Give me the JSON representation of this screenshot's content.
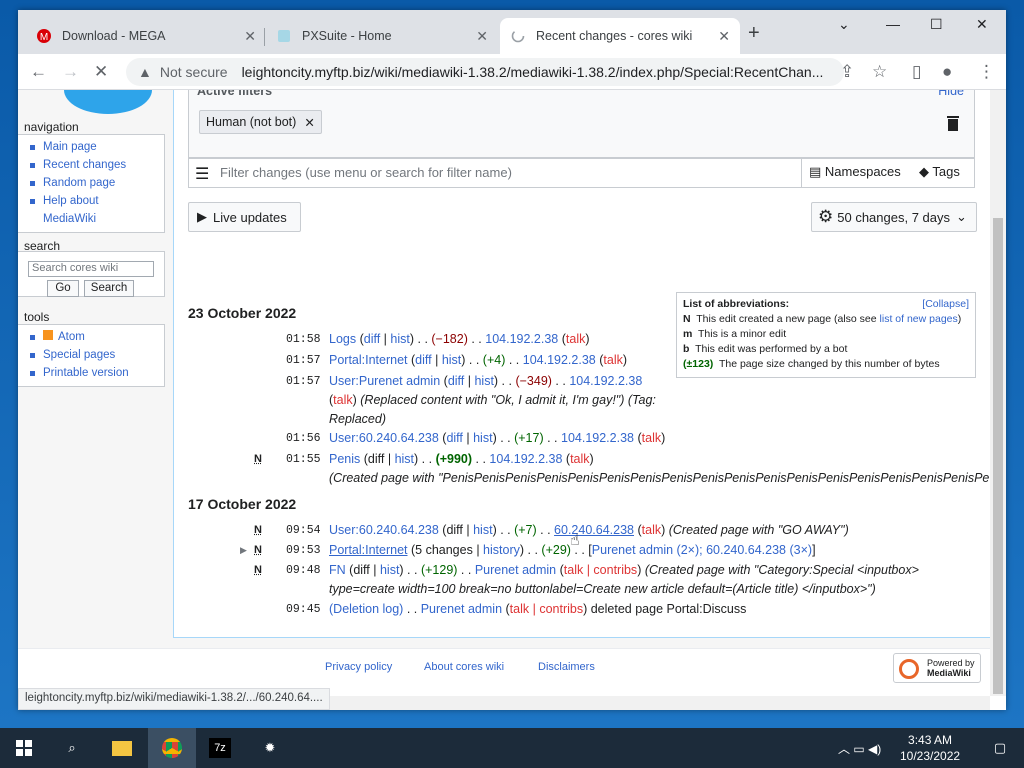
{
  "browser": {
    "tabs": [
      {
        "title": "Download - MEGA",
        "icon": "mega-icon"
      },
      {
        "title": "PXSuite - Home",
        "icon": "pxsuite-icon"
      },
      {
        "title": "Recent changes - cores wiki",
        "icon": "loading-icon"
      }
    ],
    "url_label": "Not secure",
    "url": "leightoncity.myftp.biz/wiki/mediawiki-1.38.2/mediawiki-1.38.2/index.php/Special:RecentChan...",
    "status_url": "leightoncity.myftp.biz/wiki/mediawiki-1.38.2/.../60.240.64...."
  },
  "sidebar": {
    "navigation": {
      "heading": "navigation",
      "items": [
        "Main page",
        "Recent changes",
        "Random page",
        "Help about",
        "MediaWiki"
      ]
    },
    "search": {
      "heading": "search",
      "placeholder": "Search cores wiki",
      "go": "Go",
      "search": "Search"
    },
    "tools": {
      "heading": "tools",
      "items": [
        "Atom",
        "Special pages",
        "Printable version"
      ]
    }
  },
  "filters": {
    "active_label": "Active filters",
    "hide": "Hide",
    "chip": "Human (not bot)",
    "search_placeholder": "Filter changes (use menu or search for filter name)",
    "namespaces": "Namespaces",
    "tags": "Tags",
    "live": "Live updates",
    "summary": "50 changes, 7 days"
  },
  "legend": {
    "title": "List of abbreviations:",
    "collapse": "[Collapse]",
    "n_key": "N",
    "n_text": "This edit created a new page (also see ",
    "n_link": "list of new pages",
    "n_end": ")",
    "m_key": "m",
    "m_text": "This is a minor edit",
    "b_key": "b",
    "b_text": "This edit was performed by a bot",
    "s_key": "(±123)",
    "s_text": "The page size changed by this number of bytes"
  },
  "days": [
    {
      "date": "23 October 2022",
      "rows": [
        {
          "flag": "",
          "time": "01:58",
          "page": "Logs",
          "diff": "diff",
          "hist": "hist",
          "size": "(−182)",
          "user": "104.192.2.38",
          "talk": "talk",
          "extra": ""
        },
        {
          "flag": "",
          "time": "01:57",
          "page": "Portal:Internet",
          "diff": "diff",
          "hist": "hist",
          "size": "(+4)",
          "user": "104.192.2.38",
          "talk": "talk",
          "extra": ""
        },
        {
          "flag": "",
          "time": "01:57",
          "page": "User:Purenet admin",
          "diff": "diff",
          "hist": "hist",
          "size": "(−349)",
          "user": "104.192.2.38",
          "talk": "talk",
          "extra": "(Replaced content with \"Ok, I admit it, I'm gay!\") (Tag: Replaced)"
        },
        {
          "flag": "",
          "time": "01:56",
          "page": "User:60.240.64.238",
          "diff": "diff",
          "hist": "hist",
          "size": "(+17)",
          "user": "104.192.2.38",
          "talk": "talk",
          "extra": ""
        },
        {
          "flag": "N",
          "time": "01:55",
          "page": "Penis",
          "diff": "diff",
          "hist": "hist",
          "size": "(+990)",
          "user": "104.192.2.38",
          "talk": "talk",
          "extra": "(Created page with \"PenisPenisPenisPenisPenisPenisPenisPenisPenisPenisPenisPenisPenisPenisPenisPenisPenisPenisPeni"
        }
      ]
    },
    {
      "date": "17 October 2022",
      "rows": [
        {
          "flag": "N",
          "time": "09:54",
          "page": "User:60.240.64.238",
          "diff": "diff",
          "hist": "hist",
          "size": "(+7)",
          "user": "60.240.64.238",
          "talk": "talk",
          "extra": "(Created page with \"GO AWAY\")"
        },
        {
          "flag": "N",
          "time": "09:53",
          "page": "Portal:Internet",
          "diff": "5 changes",
          "hist": "history",
          "size": "(+29)",
          "user": "Purenet admin (2×); 60.240.64.238 (3×)",
          "talk": "",
          "extra": ""
        },
        {
          "flag": "N",
          "time": "09:48",
          "page": "FN",
          "diff": "diff",
          "hist": "hist",
          "size": "(+129)",
          "user": "Purenet admin",
          "talk": "talk | contribs",
          "extra": "(Created page with \"Category:Special <inputbox> type=create width=100 break=no buttonlabel=Create new article default=(Article title) </inputbox>\")"
        },
        {
          "flag": "",
          "time": "09:45",
          "page": "(Deletion log)",
          "diff": "",
          "hist": "",
          "size": "",
          "user": "Purenet admin",
          "talk": "talk | contribs",
          "extra": "deleted page Portal:Discuss"
        }
      ]
    }
  ],
  "footer": {
    "privacy": "Privacy policy",
    "about": "About cores wiki",
    "disclaimers": "Disclaimers",
    "powered1": "Powered by",
    "powered2": "MediaWiki"
  },
  "taskbar": {
    "time": "3:43 AM",
    "date": "10/23/2022"
  }
}
